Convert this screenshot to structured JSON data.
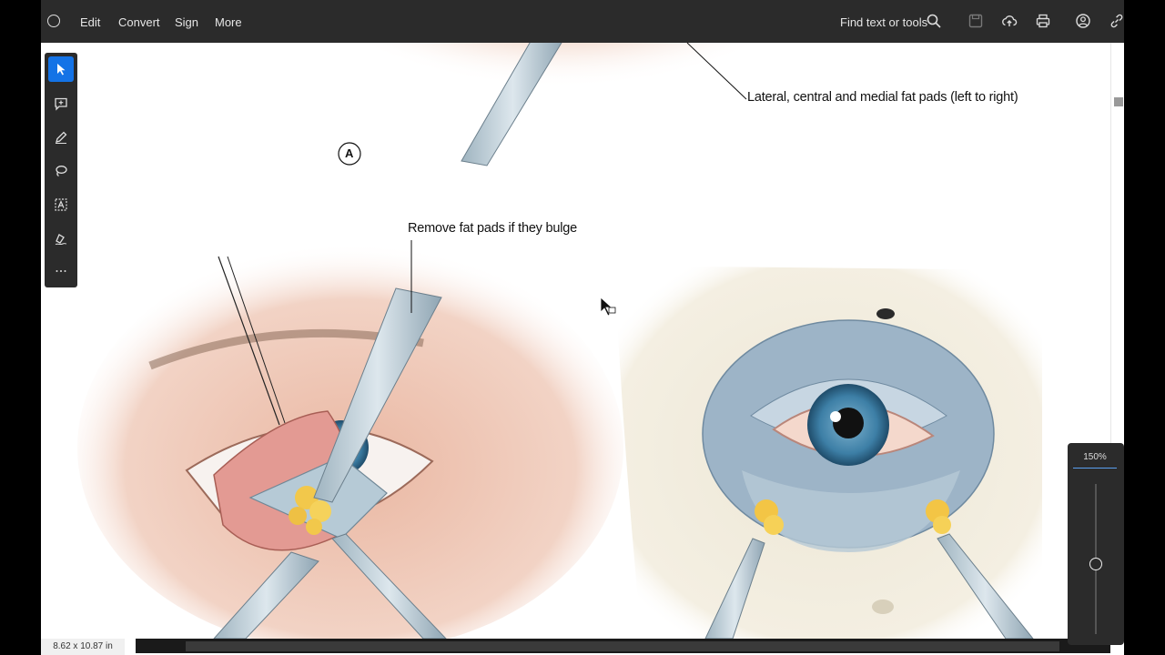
{
  "toolbar": {
    "menu": [
      "Edit",
      "Convert",
      "Sign",
      "More"
    ],
    "find_label": "Find text or tools"
  },
  "document": {
    "label_fat_pads": "Lateral, central and medial fat pads (left to right)",
    "label_remove": "Remove fat pads if they bulge",
    "figure_marker": "A"
  },
  "status": {
    "page_size": "8.62 x 10.87 in"
  },
  "zoom": {
    "percent": "150%",
    "level": 150
  },
  "colors": {
    "accent": "#1473e6",
    "toolbar_bg": "#2b2b2b"
  }
}
